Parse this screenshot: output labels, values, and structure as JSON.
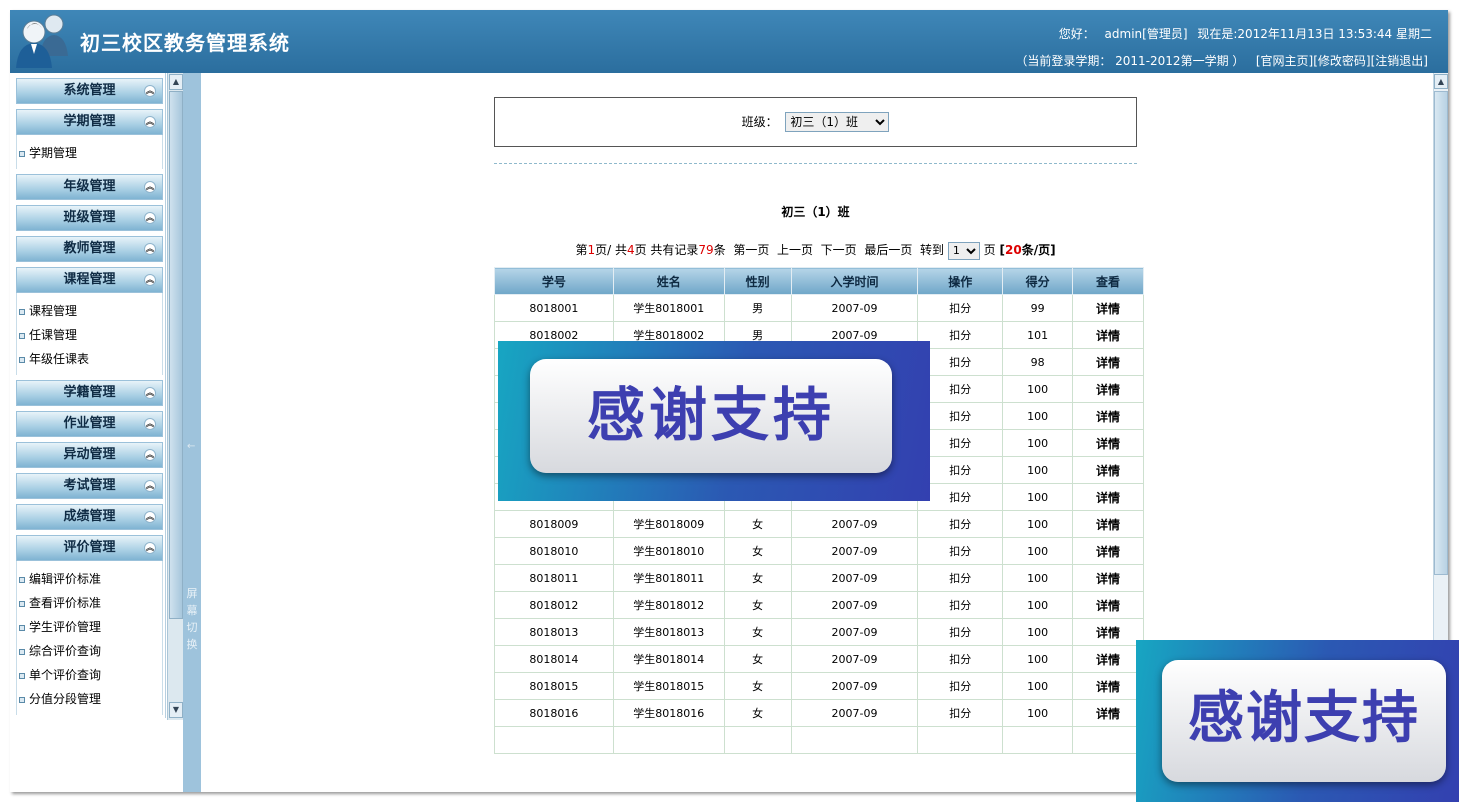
{
  "header": {
    "title": "初三校区教务管理系统",
    "greeting": "您好：",
    "user": "admin[管理员]",
    "now_label": "现在是:2012年11月13日 13:53:44 星期二",
    "term_prefix": "（当前登录学期：",
    "term_value": "2011-2012第一学期",
    "term_suffix": "）",
    "links": [
      "[官网主页]",
      "[修改密码]",
      "[注销退出]"
    ]
  },
  "sidebar": {
    "groups": [
      {
        "title": "系统管理",
        "items": []
      },
      {
        "title": "学期管理",
        "items": [
          "学期管理"
        ]
      },
      {
        "title": "年级管理",
        "items": []
      },
      {
        "title": "班级管理",
        "items": []
      },
      {
        "title": "教师管理",
        "items": []
      },
      {
        "title": "课程管理",
        "items": [
          "课程管理",
          "任课管理",
          "年级任课表"
        ]
      },
      {
        "title": "学籍管理",
        "items": []
      },
      {
        "title": "作业管理",
        "items": []
      },
      {
        "title": "异动管理",
        "items": []
      },
      {
        "title": "考试管理",
        "items": []
      },
      {
        "title": "成绩管理",
        "items": []
      },
      {
        "title": "评价管理",
        "items": [
          "编辑评价标准",
          "查看评价标准",
          "学生评价管理",
          "综合评价查询",
          "单个评价查询",
          "分值分段管理"
        ]
      }
    ],
    "collapse_icon": "double-chevron-up-icon"
  },
  "splitter": {
    "arrow": "←",
    "label": "屏幕切换"
  },
  "filter": {
    "label": "班级：",
    "selected": "初三（1）班"
  },
  "class_title": "初三（1）班",
  "pager": {
    "p1": "第",
    "current_page": "1",
    "p2": "页/ 共",
    "total_pages": "4",
    "p3": "页 共有记录",
    "total_records": "79",
    "p4": "条",
    "first": "第一页",
    "prev": "上一页",
    "next": "下一页",
    "last": "最后一页",
    "goto": "转到",
    "goto_value": "1",
    "page_unit": "页",
    "per_page_open": "[",
    "per_page": "20",
    "per_page_close": "条/页]"
  },
  "table": {
    "headers": [
      "学号",
      "姓名",
      "性别",
      "入学时间",
      "操作",
      "得分",
      "查看"
    ],
    "rows": [
      [
        "8018001",
        "学生8018001",
        "男",
        "2007-09",
        "扣分",
        "99",
        "详情"
      ],
      [
        "8018002",
        "学生8018002",
        "男",
        "2007-09",
        "扣分",
        "101",
        "详情"
      ],
      [
        "",
        "",
        "",
        "",
        "扣分",
        "98",
        "详情"
      ],
      [
        "",
        "",
        "",
        "",
        "扣分",
        "100",
        "详情"
      ],
      [
        "",
        "",
        "",
        "",
        "扣分",
        "100",
        "详情"
      ],
      [
        "",
        "",
        "",
        "",
        "扣分",
        "100",
        "详情"
      ],
      [
        "",
        "",
        "",
        "",
        "扣分",
        "100",
        "详情"
      ],
      [
        "",
        "",
        "",
        "",
        "扣分",
        "100",
        "详情"
      ],
      [
        "8018009",
        "学生8018009",
        "女",
        "2007-09",
        "扣分",
        "100",
        "详情"
      ],
      [
        "8018010",
        "学生8018010",
        "女",
        "2007-09",
        "扣分",
        "100",
        "详情"
      ],
      [
        "8018011",
        "学生8018011",
        "女",
        "2007-09",
        "扣分",
        "100",
        "详情"
      ],
      [
        "8018012",
        "学生8018012",
        "女",
        "2007-09",
        "扣分",
        "100",
        "详情"
      ],
      [
        "8018013",
        "学生8018013",
        "女",
        "2007-09",
        "扣分",
        "100",
        "详情"
      ],
      [
        "8018014",
        "学生8018014",
        "女",
        "2007-09",
        "扣分",
        "100",
        "详情"
      ],
      [
        "8018015",
        "学生8018015",
        "女",
        "2007-09",
        "扣分",
        "100",
        "详情"
      ],
      [
        "8018016",
        "学生8018016",
        "女",
        "2007-09",
        "扣分",
        "100",
        "详情"
      ],
      [
        "",
        "",
        "",
        "",
        "",
        "",
        ""
      ]
    ]
  },
  "watermark": {
    "text": "感谢支持"
  },
  "colors": {
    "header_bg": "#2f76a6",
    "table_header": "#8dbad6",
    "menu_head": "#a9cfe4",
    "accent_red": "#dd0000"
  }
}
